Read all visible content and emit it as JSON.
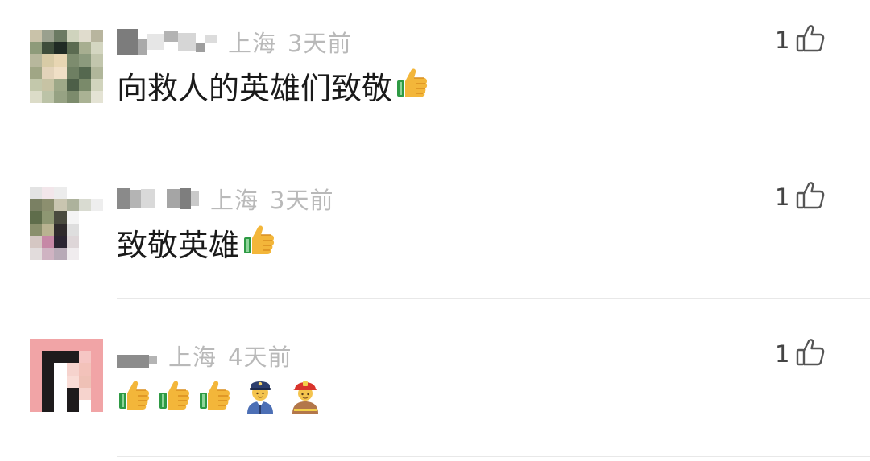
{
  "comments": [
    {
      "location": "上海",
      "time": "3天前",
      "text": "向救人的英雄们致敬",
      "emojis": [
        "thumbs-up-icon"
      ],
      "likes": "1"
    },
    {
      "location": "上海",
      "time": "3天前",
      "text": "致敬英雄",
      "emojis": [
        "thumbs-up-icon"
      ],
      "likes": "1"
    },
    {
      "location": "上海",
      "time": "4天前",
      "text": "",
      "emojis": [
        "thumbs-up-icon",
        "thumbs-up-icon",
        "thumbs-up-icon",
        "police-officer-icon",
        "firefighter-icon"
      ],
      "likes": "1"
    }
  ],
  "colors": {
    "meta_text": "#b9b9b9",
    "body_text": "#1a1a1a",
    "divider": "#e8e8e8",
    "like_icon": "#555555"
  }
}
